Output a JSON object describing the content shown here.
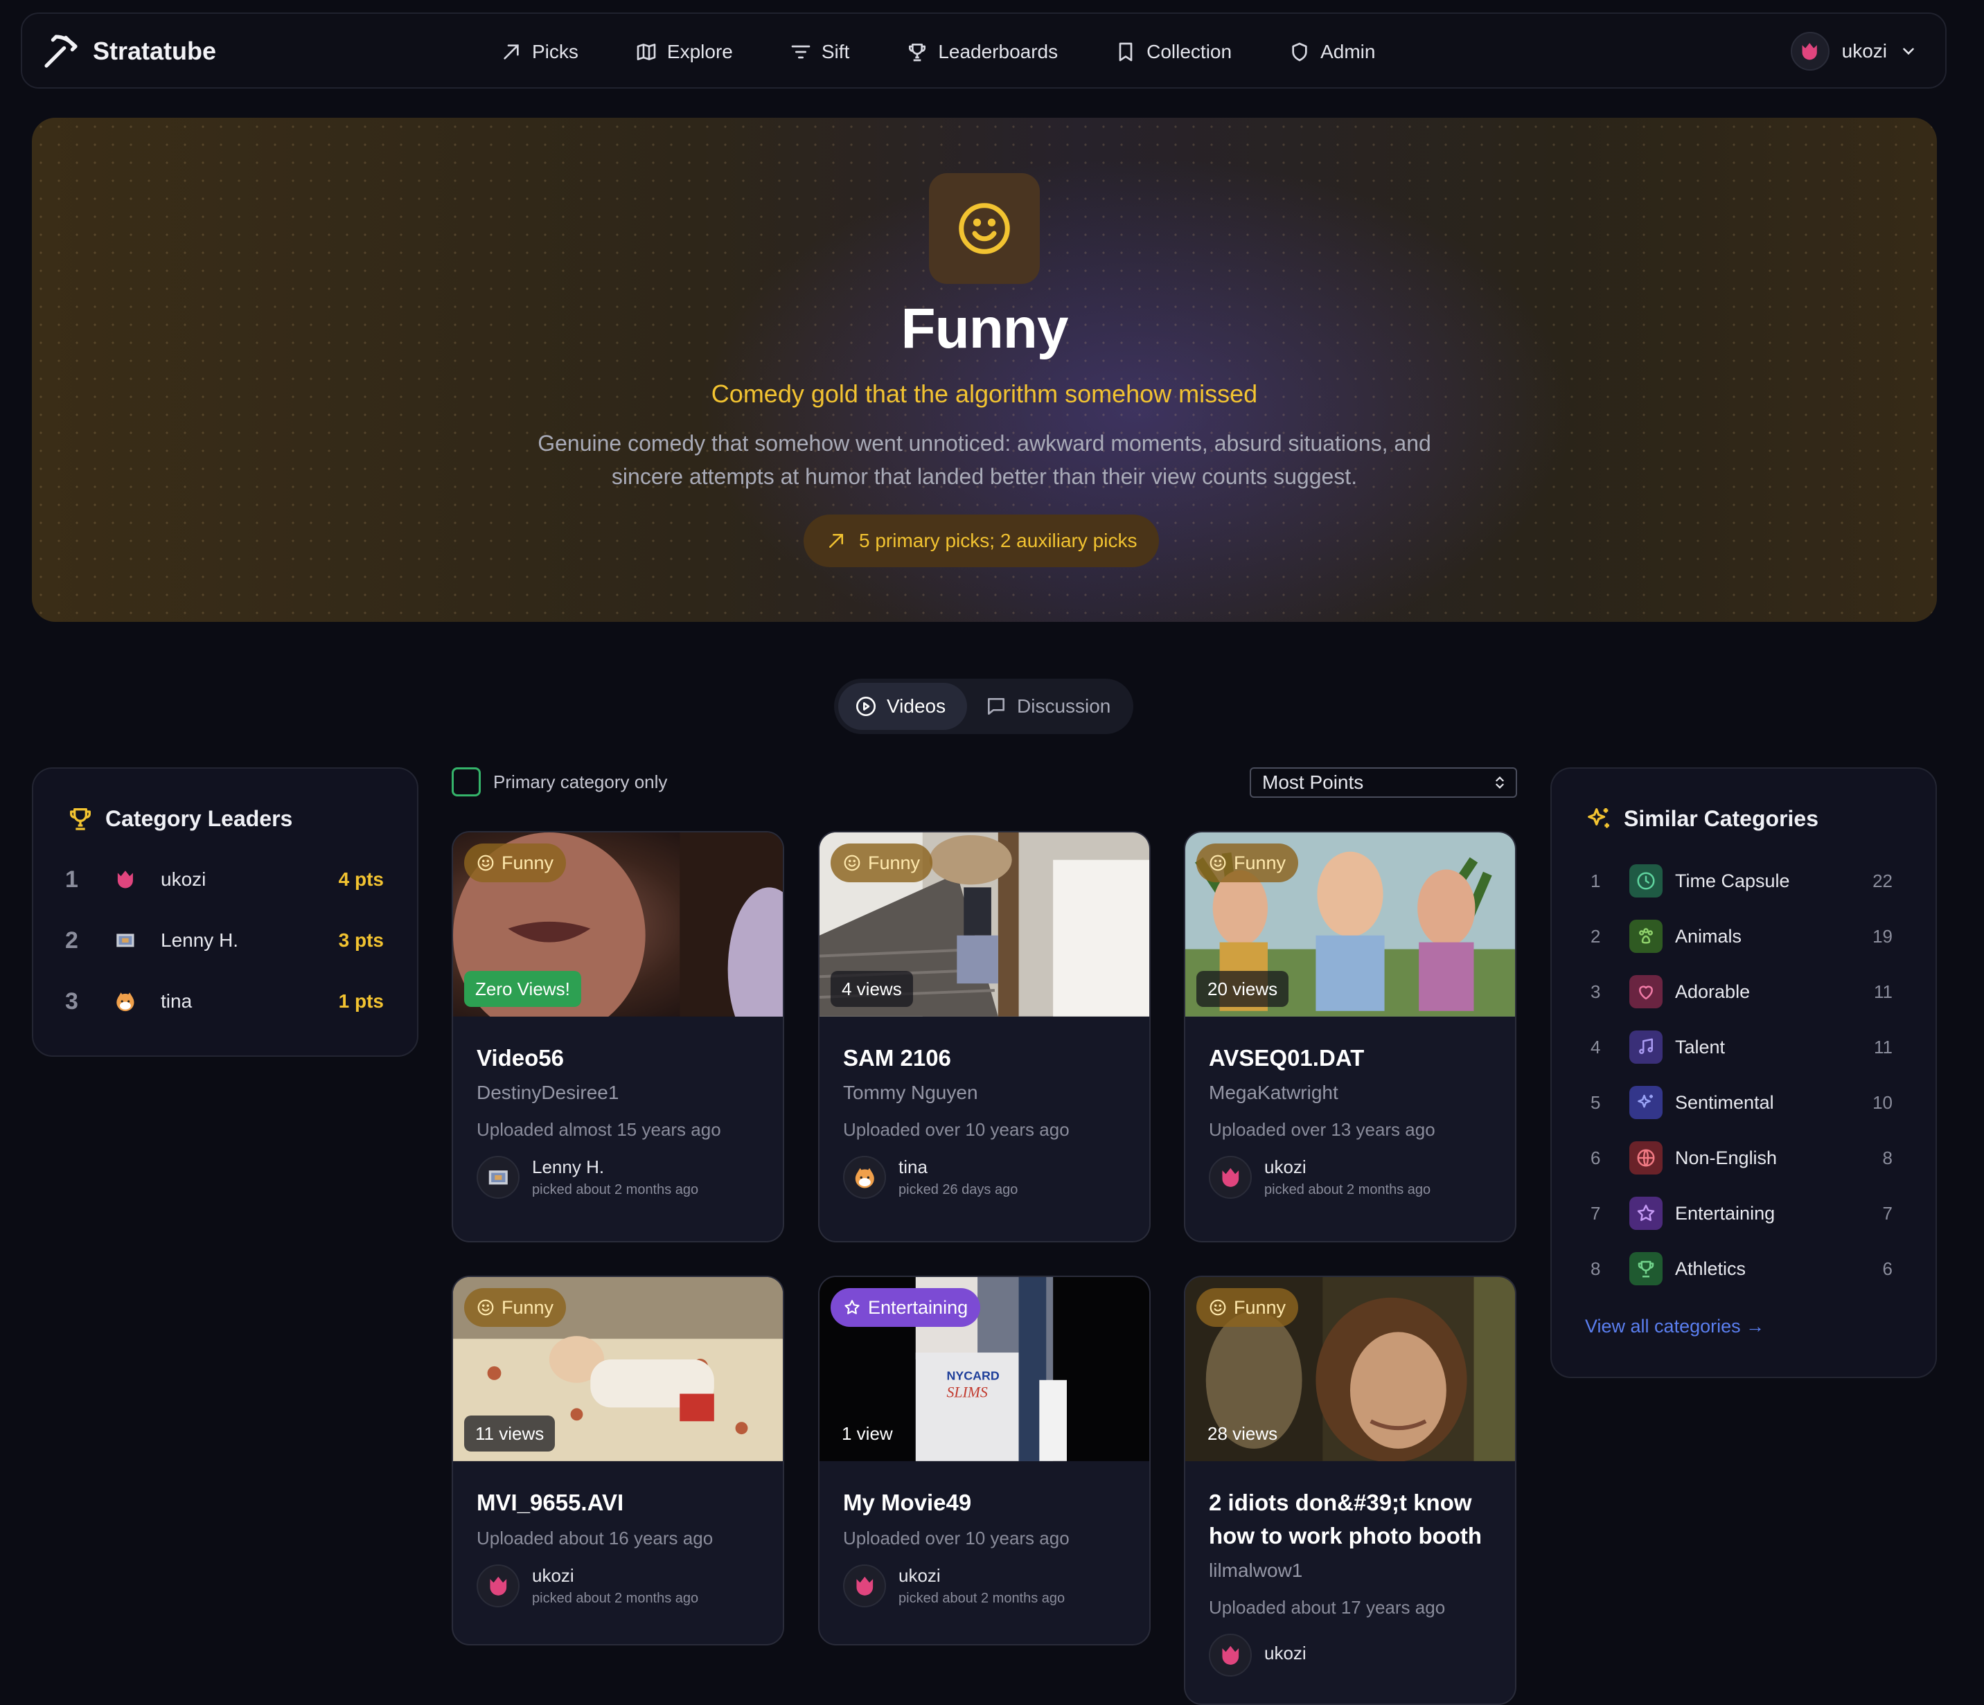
{
  "app": {
    "name": "Stratatube"
  },
  "nav": {
    "links": [
      {
        "label": "Picks",
        "icon": "arrow-up-right-icon"
      },
      {
        "label": "Explore",
        "icon": "map-icon"
      },
      {
        "label": "Sift",
        "icon": "filter-icon"
      },
      {
        "label": "Leaderboards",
        "icon": "trophy-icon"
      },
      {
        "label": "Collection",
        "icon": "bookmark-icon"
      },
      {
        "label": "Admin",
        "icon": "shield-icon"
      }
    ],
    "user": "ukozi"
  },
  "hero": {
    "title": "Funny",
    "tagline": "Comedy gold that the algorithm somehow missed",
    "description": "Genuine comedy that somehow went unnoticed: awkward moments, absurd situations, and sincere attempts at humor that landed better than their view counts suggest.",
    "picks_summary": "5 primary picks; 2 auxiliary picks",
    "accent": "#f2c331"
  },
  "tabs": {
    "videos": "Videos",
    "discussion": "Discussion",
    "active": "Videos"
  },
  "leaders": {
    "title": "Category Leaders",
    "rows": [
      {
        "rank": "1",
        "name": "ukozi",
        "points": "4 pts"
      },
      {
        "rank": "2",
        "name": "Lenny H.",
        "points": "3 pts"
      },
      {
        "rank": "3",
        "name": "tina",
        "points": "1 pts"
      }
    ]
  },
  "filters": {
    "primary_only_label": "Primary category only",
    "primary_only_checked": false,
    "sort_selected": "Most Points"
  },
  "videos": [
    {
      "category": "Funny",
      "views": "Zero Views!",
      "title": "Video56",
      "channel": "DestinyDesiree1",
      "uploaded": "Uploaded almost 15 years ago",
      "picker": "Lenny H.",
      "picked": "picked about 2 months ago"
    },
    {
      "category": "Funny",
      "views": "4 views",
      "title": "SAM 2106",
      "channel": "Tommy Nguyen",
      "uploaded": "Uploaded over 10 years ago",
      "picker": "tina",
      "picked": "picked 26 days ago"
    },
    {
      "category": "Funny",
      "views": "20 views",
      "title": "AVSEQ01.DAT",
      "channel": "MegaKatwright",
      "uploaded": "Uploaded over 13 years ago",
      "picker": "ukozi",
      "picked": "picked about 2 months ago"
    },
    {
      "category": "Funny",
      "views": "11 views",
      "title": "MVI_9655.AVI",
      "channel": "",
      "uploaded": "Uploaded about 16 years ago",
      "picker": "ukozi",
      "picked": "picked about 2 months ago"
    },
    {
      "category": "Entertaining",
      "views": "1 view",
      "title": "My Movie49",
      "channel": "",
      "uploaded": "Uploaded over 10 years ago",
      "picker": "ukozi",
      "picked": "picked about 2 months ago"
    },
    {
      "category": "Funny",
      "views": "28 views",
      "title": "2 idiots don&#39;t know how to work photo booth",
      "channel": "lilmalwow1",
      "uploaded": "Uploaded about 17 years ago",
      "picker": "ukozi",
      "picked": ""
    }
  ],
  "similar": {
    "title": "Similar Categories",
    "rows": [
      {
        "rank": "1",
        "name": "Time Capsule",
        "count": "22",
        "icon": "clock-icon",
        "color": "#2f9e6e"
      },
      {
        "rank": "2",
        "name": "Animals",
        "count": "19",
        "icon": "paw-icon",
        "color": "#4ea43a"
      },
      {
        "rank": "3",
        "name": "Adorable",
        "count": "11",
        "icon": "heart-icon",
        "color": "#d2467a"
      },
      {
        "rank": "4",
        "name": "Talent",
        "count": "11",
        "icon": "music-icon",
        "color": "#6b55d6"
      },
      {
        "rank": "5",
        "name": "Sentimental",
        "count": "10",
        "icon": "sparkles-icon",
        "color": "#5a5ee0"
      },
      {
        "rank": "6",
        "name": "Non-English",
        "count": "8",
        "icon": "globe-icon",
        "color": "#cf3f4f"
      },
      {
        "rank": "7",
        "name": "Entertaining",
        "count": "7",
        "icon": "star-icon",
        "color": "#8a4fd8"
      },
      {
        "rank": "8",
        "name": "Athletics",
        "count": "6",
        "icon": "trophy-icon",
        "color": "#3ea35a"
      }
    ],
    "view_all": "View all categories →"
  }
}
